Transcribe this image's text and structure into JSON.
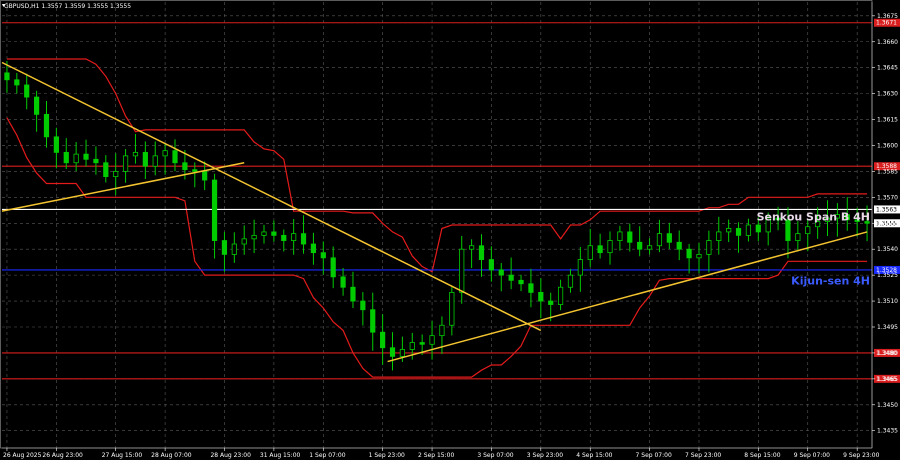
{
  "window": {
    "symbol_title": "GBPUSD,H1  1.3557 1.3559 1.3555 1.3555"
  },
  "colors": {
    "background": "#000000",
    "grid": "#5a5a5a",
    "candle_up": "#00cc00",
    "candle_down": "#00cc00",
    "trend_line": "#f4c430",
    "envelope": "#e41b1b",
    "resistance_level": "#d81e1e",
    "senkou_line": "#ffffff",
    "kijun_line": "#1a2bff",
    "kijun_text": "#3a5bff",
    "senkou_text": "#e8d8e8",
    "red_tag": "#d81e1e",
    "current_price_tag": "#ffffff"
  },
  "chart_data": {
    "type": "candlestick",
    "title": "GBPUSD,H1  1.3557 1.3559 1.3555 1.3555",
    "y_axis": {
      "range": [
        1.3425,
        1.3683
      ],
      "ticks": [
        1.3675,
        1.366,
        1.3645,
        1.363,
        1.3615,
        1.36,
        1.3585,
        1.357,
        1.3555,
        1.354,
        1.3525,
        1.351,
        1.3495,
        1.348,
        1.3465,
        1.345,
        1.3435
      ]
    },
    "x_axis": {
      "ticks": [
        "26 Aug 2025",
        "26 Aug 23:00",
        "27 Aug 15:00",
        "28 Aug 07:00",
        "28 Aug 23:00",
        "31 Aug 15:00",
        "1 Sep 07:00",
        "1 Sep 23:00",
        "2 Sep 15:00",
        "3 Sep 07:00",
        "3 Sep 23:00",
        "4 Sep 15:00",
        "7 Sep 07:00",
        "7 Sep 23:00",
        "8 Sep 15:00",
        "9 Sep 07:00",
        "9 Sep 23:00"
      ]
    },
    "levels": [
      {
        "name": "1.3671",
        "label": "1.3671",
        "value": 1.3671,
        "color": "#d81e1e"
      },
      {
        "name": "1.3588",
        "label": "1.3588",
        "value": 1.3588,
        "color": "#d81e1e"
      },
      {
        "name": "senkou-span-b",
        "label": "1.3563",
        "value": 1.3563,
        "color": "#ffffff"
      },
      {
        "name": "kijun-sen",
        "label": "1.3528",
        "value": 1.3528,
        "color": "#1a2bff"
      },
      {
        "name": "1.3480",
        "label": "1.3480",
        "value": 1.348,
        "color": "#d81e1e"
      },
      {
        "name": "1.3465",
        "label": "1.3465",
        "value": 1.3465,
        "color": "#d81e1e"
      }
    ],
    "current_price": {
      "label": "1.3555",
      "value": 1.3555
    },
    "annotations": [
      {
        "name": "senkou",
        "text": "Senkou Span B 4H",
        "value": 1.3559,
        "color": "#e8d8e8"
      },
      {
        "name": "kijun",
        "text": "Kijun-sen 4H",
        "value": 1.3522,
        "color": "#3a5bff"
      }
    ],
    "trend_lines": [
      {
        "name": "down-trend",
        "from": [
          0,
          1.3648
        ],
        "to": [
          54,
          1.3493
        ]
      },
      {
        "name": "up-trend-1",
        "from": [
          0,
          1.3562
        ],
        "to": [
          24,
          1.359
        ]
      },
      {
        "name": "up-trend-2",
        "from": [
          39,
          1.3475
        ],
        "to": [
          87,
          1.355
        ]
      }
    ],
    "candles": {
      "count": 88,
      "close": [
        1.3638,
        1.3635,
        1.3628,
        1.3618,
        1.3605,
        1.3596,
        1.359,
        1.3595,
        1.3592,
        1.359,
        1.3582,
        1.3585,
        1.3594,
        1.3596,
        1.3588,
        1.3594,
        1.3597,
        1.359,
        1.3586,
        1.3585,
        1.358,
        1.3545,
        1.3537,
        1.3543,
        1.3546,
        1.3548,
        1.355,
        1.3548,
        1.3545,
        1.3549,
        1.3543,
        1.3538,
        1.3535,
        1.3524,
        1.3518,
        1.351,
        1.3505,
        1.3492,
        1.3483,
        1.3478,
        1.3482,
        1.3486,
        1.3485,
        1.349,
        1.3496,
        1.3515,
        1.354,
        1.3542,
        1.3534,
        1.3528,
        1.3525,
        1.3522,
        1.352,
        1.3515,
        1.351,
        1.3508,
        1.3518,
        1.3525,
        1.3534,
        1.3542,
        1.3538,
        1.3545,
        1.355,
        1.3544,
        1.354,
        1.3542,
        1.3549,
        1.3544,
        1.354,
        1.3535,
        1.3537,
        1.3545,
        1.355,
        1.3552,
        1.3548,
        1.3554,
        1.355,
        1.3558,
        1.3557,
        1.3545,
        1.3549,
        1.3553,
        1.3556,
        1.3558,
        1.356,
        1.3557,
        1.3556,
        1.3555
      ]
    },
    "bands": {
      "upper": [
        1.3665,
        1.3665,
        1.3665,
        1.3665,
        1.3665,
        1.3665,
        1.3665,
        1.3665,
        1.3665,
        1.3665,
        1.3665,
        1.3665,
        1.3665,
        1.3665,
        1.3665,
        1.3665,
        1.3665,
        1.3665,
        1.3665,
        1.3665,
        1.3665,
        1.3665,
        1.3665,
        1.3665,
        1.3665,
        1.3665,
        1.3665,
        1.3665,
        1.3665,
        1.3665,
        1.3665,
        1.3665,
        1.3665,
        1.3665,
        1.3665,
        1.3665,
        1.3665,
        1.3665,
        1.3665,
        1.3665,
        1.3665,
        1.3665,
        1.3665,
        1.3665,
        1.3665,
        1.3665,
        1.3665,
        1.3665,
        1.3665,
        1.3665,
        1.3665,
        1.3665,
        1.3665,
        1.3665,
        1.3665,
        1.3665,
        1.3665,
        1.3665,
        1.3665,
        1.3665,
        1.3665,
        1.3665,
        1.3665,
        1.3665,
        1.3665,
        1.3665,
        1.3665,
        1.3665,
        1.3665,
        1.3665,
        1.3665,
        1.3665,
        1.3665,
        1.3665,
        1.3665,
        1.3665,
        1.3665,
        1.3665,
        1.3665,
        1.3665,
        1.3665,
        1.3665,
        1.3665,
        1.3665,
        1.3665,
        1.3665,
        1.3665,
        1.3665
      ],
      "lower": [
        1.3425,
        1.3425,
        1.3425,
        1.3425,
        1.3425,
        1.3425,
        1.3425,
        1.3425,
        1.3425,
        1.3425,
        1.3425,
        1.3425,
        1.3425,
        1.3425,
        1.3425,
        1.3425,
        1.3425,
        1.3425,
        1.3425,
        1.3425,
        1.3425,
        1.3425,
        1.3425,
        1.3425,
        1.3425,
        1.3425,
        1.3425,
        1.3425,
        1.3425,
        1.3425,
        1.3425,
        1.3425,
        1.3425,
        1.3425,
        1.3425,
        1.3425,
        1.3425,
        1.3425,
        1.3425,
        1.3425,
        1.3425,
        1.3425,
        1.3425,
        1.3425,
        1.3425,
        1.3425,
        1.3425,
        1.3425,
        1.3425,
        1.3425,
        1.3425,
        1.3425,
        1.3425,
        1.3425,
        1.3425,
        1.3425,
        1.3425,
        1.3425,
        1.3425,
        1.3425,
        1.3425,
        1.3425,
        1.3425,
        1.3425,
        1.3425,
        1.3425,
        1.3425,
        1.3425,
        1.3425,
        1.3425,
        1.3425,
        1.3425,
        1.3425,
        1.3425,
        1.3425,
        1.3425,
        1.3425,
        1.3425,
        1.3425,
        1.3425,
        1.3425,
        1.3425,
        1.3425,
        1.3425,
        1.3425,
        1.3425,
        1.3425,
        1.3425
      ]
    }
  }
}
